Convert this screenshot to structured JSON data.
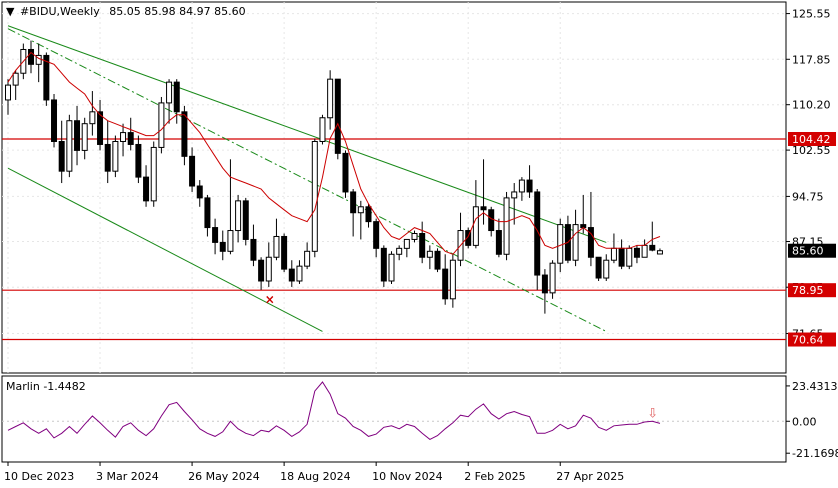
{
  "header": {
    "symbol": "#BIDU,Weekly",
    "ohlc": "85.05 85.98 84.97 85.60"
  },
  "colors": {
    "bull_candle": "#ffffff",
    "bear_candle": "#000000",
    "channel": "#1a8a1a",
    "ma_line": "#cc0000",
    "level_line": "#d40000",
    "price_badge": "#000000",
    "oscillator": "#800080",
    "signal_arrow": "#e06060"
  },
  "chart_data": [
    {
      "type": "candlestick",
      "title": "",
      "ylim": [
        65.0,
        127.5
      ],
      "y_ticks": [
        "125.55",
        "117.85",
        "110.20",
        "102.55",
        "94.75",
        "87.15",
        "79.45",
        "71.65"
      ],
      "x_ticks": [
        "10 Dec 2023",
        "3 Mar 2024",
        "26 May 2024",
        "18 Aug 2024",
        "10 Nov 2024",
        "2 Feb 2025",
        "27 Apr 2025"
      ],
      "x_tick_index": [
        0,
        12,
        24,
        36,
        48,
        60,
        72
      ],
      "grid": true,
      "candles": [
        [
          111.0,
          114.5,
          108.5,
          113.5
        ],
        [
          113.5,
          116.0,
          111.0,
          115.5
        ],
        [
          115.5,
          120.5,
          114.5,
          119.5
        ],
        [
          119.5,
          121.0,
          115.5,
          117.0
        ],
        [
          117.0,
          120.5,
          114.0,
          118.5
        ],
        [
          118.5,
          119.0,
          110.0,
          111.0
        ],
        [
          111.0,
          112.0,
          103.0,
          104.0
        ],
        [
          104.0,
          107.5,
          97.0,
          99.0
        ],
        [
          99.0,
          108.5,
          98.0,
          107.5
        ],
        [
          107.5,
          110.0,
          100.0,
          102.5
        ],
        [
          102.5,
          108.0,
          101.0,
          107.0
        ],
        [
          107.0,
          112.5,
          105.0,
          109.0
        ],
        [
          109.0,
          111.0,
          102.5,
          103.5
        ],
        [
          103.5,
          107.5,
          97.0,
          99.0
        ],
        [
          99.0,
          105.0,
          98.0,
          104.0
        ],
        [
          104.0,
          107.0,
          101.5,
          105.5
        ],
        [
          105.5,
          108.0,
          102.5,
          103.5
        ],
        [
          103.5,
          105.0,
          97.0,
          98.0
        ],
        [
          98.0,
          100.0,
          93.0,
          94.0
        ],
        [
          94.0,
          104.0,
          93.0,
          103.0
        ],
        [
          103.0,
          111.5,
          102.0,
          110.5
        ],
        [
          110.5,
          114.5,
          107.0,
          114.0
        ],
        [
          114.0,
          114.5,
          107.0,
          109.0
        ],
        [
          109.0,
          110.0,
          100.0,
          101.5
        ],
        [
          101.5,
          103.0,
          95.5,
          96.5
        ],
        [
          96.5,
          97.5,
          93.0,
          94.5
        ],
        [
          94.5,
          95.0,
          88.0,
          89.5
        ],
        [
          89.5,
          91.0,
          85.0,
          87.0
        ],
        [
          87.0,
          89.0,
          84.0,
          85.5
        ],
        [
          85.5,
          101.0,
          85.0,
          89.0
        ],
        [
          89.0,
          95.0,
          87.0,
          94.0
        ],
        [
          94.0,
          94.5,
          86.5,
          87.5
        ],
        [
          87.5,
          90.0,
          83.0,
          84.0
        ],
        [
          84.0,
          84.5,
          79.0,
          80.5
        ],
        [
          80.5,
          87.0,
          79.5,
          84.5
        ],
        [
          84.5,
          91.0,
          84.0,
          88.0
        ],
        [
          88.0,
          88.5,
          82.0,
          82.5
        ],
        [
          82.5,
          84.0,
          79.5,
          80.5
        ],
        [
          80.5,
          84.0,
          80.0,
          83.0
        ],
        [
          83.0,
          87.0,
          82.5,
          85.5
        ],
        [
          85.5,
          104.5,
          84.5,
          104.0
        ],
        [
          104.0,
          108.5,
          103.5,
          108.0
        ],
        [
          108.0,
          116.0,
          106.0,
          114.5
        ],
        [
          114.5,
          114.5,
          101.0,
          102.0
        ],
        [
          102.0,
          102.5,
          94.5,
          95.5
        ],
        [
          95.5,
          96.0,
          88.0,
          92.0
        ],
        [
          92.0,
          94.0,
          87.5,
          93.0
        ],
        [
          93.0,
          93.5,
          89.5,
          90.5
        ],
        [
          90.5,
          91.0,
          84.5,
          86.0
        ],
        [
          86.0,
          86.5,
          79.5,
          80.5
        ],
        [
          80.5,
          85.5,
          80.0,
          85.0
        ],
        [
          85.0,
          86.5,
          84.0,
          86.0
        ],
        [
          86.0,
          87.5,
          84.5,
          87.5
        ],
        [
          87.5,
          89.0,
          87.0,
          88.5
        ],
        [
          88.5,
          90.5,
          83.5,
          84.5
        ],
        [
          84.5,
          86.5,
          82.5,
          85.5
        ],
        [
          85.5,
          86.0,
          82.0,
          82.5
        ],
        [
          82.5,
          85.0,
          76.5,
          77.5
        ],
        [
          77.5,
          85.0,
          76.0,
          84.0
        ],
        [
          84.0,
          92.0,
          83.0,
          89.0
        ],
        [
          89.0,
          89.5,
          86.0,
          86.5
        ],
        [
          86.5,
          97.5,
          86.0,
          93.0
        ],
        [
          93.0,
          101.0,
          90.0,
          92.5
        ],
        [
          92.5,
          93.0,
          88.0,
          89.0
        ],
        [
          89.0,
          91.0,
          84.5,
          85.0
        ],
        [
          85.0,
          95.5,
          84.0,
          94.5
        ],
        [
          94.5,
          97.0,
          90.0,
          95.5
        ],
        [
          95.5,
          98.0,
          94.0,
          97.5
        ],
        [
          97.5,
          100.0,
          94.5,
          95.5
        ],
        [
          95.5,
          96.0,
          79.0,
          81.5
        ],
        [
          81.5,
          82.5,
          75.0,
          78.5
        ],
        [
          78.5,
          84.0,
          77.5,
          83.5
        ],
        [
          83.5,
          91.0,
          82.0,
          90.0
        ],
        [
          90.0,
          91.5,
          83.5,
          84.0
        ],
        [
          84.0,
          92.5,
          83.0,
          90.0
        ],
        [
          90.0,
          95.0,
          88.5,
          89.5
        ],
        [
          89.5,
          95.5,
          83.0,
          84.5
        ],
        [
          84.5,
          84.5,
          80.5,
          81.0
        ],
        [
          81.0,
          85.0,
          80.5,
          84.0
        ],
        [
          84.0,
          88.5,
          83.5,
          86.0
        ],
        [
          86.0,
          87.5,
          82.5,
          83.0
        ],
        [
          83.0,
          86.5,
          82.5,
          86.0
        ],
        [
          86.0,
          86.5,
          83.5,
          84.5
        ],
        [
          84.5,
          87.5,
          84.5,
          86.5
        ],
        [
          86.5,
          90.5,
          85.5,
          85.7
        ],
        [
          85.05,
          85.98,
          84.97,
          85.6
        ]
      ],
      "moving_average": [
        114.0,
        116.0,
        117.5,
        119.0,
        118.0,
        117.5,
        117.0,
        115.5,
        114.0,
        113.0,
        112.0,
        110.0,
        108.5,
        107.5,
        107.0,
        106.5,
        106.0,
        105.5,
        105.0,
        105.0,
        106.0,
        107.5,
        108.5,
        108.5,
        107.0,
        105.5,
        103.5,
        101.5,
        99.5,
        98.0,
        97.5,
        97.0,
        96.5,
        96.0,
        94.5,
        93.5,
        92.5,
        91.5,
        91.0,
        90.5,
        92.5,
        98.0,
        104.5,
        107.0,
        104.0,
        100.0,
        96.0,
        93.5,
        91.5,
        89.5,
        88.0,
        87.5,
        88.5,
        89.5,
        89.0,
        88.5,
        87.0,
        85.5,
        85.0,
        86.5,
        88.0,
        91.0,
        92.0,
        91.0,
        90.5,
        90.5,
        91.0,
        91.5,
        91.0,
        89.0,
        86.5,
        86.0,
        86.5,
        87.0,
        88.5,
        89.5,
        88.5,
        86.5,
        86.0,
        86.0,
        86.0,
        86.0,
        86.5,
        86.5,
        87.5,
        88.0
      ],
      "horizontal_levels": [
        {
          "value": 104.42,
          "label": "104.42"
        },
        {
          "value": 78.95,
          "label": "78.95"
        },
        {
          "value": 70.64,
          "label": "70.64"
        }
      ],
      "current_price": {
        "value": 85.6,
        "label": "85.60"
      },
      "channel_lines": [
        {
          "style": "solid",
          "from": [
            0,
            123.5
          ],
          "to": [
            78,
            87.0
          ]
        },
        {
          "style": "solid",
          "from": [
            0,
            99.5
          ],
          "to": [
            41,
            72.0
          ]
        },
        {
          "style": "dash-dot",
          "from": [
            0,
            123.0
          ],
          "to": [
            78,
            72.0
          ]
        }
      ],
      "marker": {
        "symbol": "×",
        "index": 34,
        "value": 77.4
      }
    },
    {
      "type": "line",
      "title": "Marlin -1.4482",
      "ylim": [
        -27,
        30
      ],
      "y_ticks": [
        "23.4313",
        "0.00",
        "-21.1698"
      ],
      "zero_line": true,
      "values": [
        -6.0,
        -3.5,
        -1.0,
        -5.0,
        -8.0,
        -5.0,
        -11.0,
        -8.0,
        -3.5,
        -8.0,
        -2.0,
        3.5,
        -1.0,
        -6.0,
        -10.5,
        -3.5,
        -1.0,
        -6.0,
        -9.5,
        -5.0,
        3.5,
        11.0,
        12.5,
        6.5,
        1.0,
        -5.0,
        -8.0,
        -10.0,
        -7.0,
        0.0,
        -5.0,
        -8.0,
        -9.5,
        -6.0,
        -7.0,
        -3.0,
        -6.0,
        -10.0,
        -7.0,
        -2.0,
        20.0,
        26.0,
        18.0,
        5.0,
        2.0,
        -3.5,
        -6.0,
        -10.0,
        -8.5,
        -4.0,
        -3.0,
        -5.0,
        -2.0,
        -3.5,
        -8.0,
        -12.0,
        -9.5,
        -5.0,
        -1.0,
        4.0,
        3.0,
        8.0,
        11.5,
        5.0,
        1.5,
        5.0,
        6.5,
        4.5,
        3.0,
        -8.0,
        -8.0,
        -6.0,
        -2.0,
        -5.0,
        -3.0,
        4.0,
        2.0,
        -4.0,
        -6.0,
        -3.0,
        -2.5,
        -2.0,
        -2.0,
        -0.5,
        0.0,
        -1.4482
      ],
      "signal_arrow": {
        "symbol": "⇩",
        "index": 84
      }
    }
  ]
}
